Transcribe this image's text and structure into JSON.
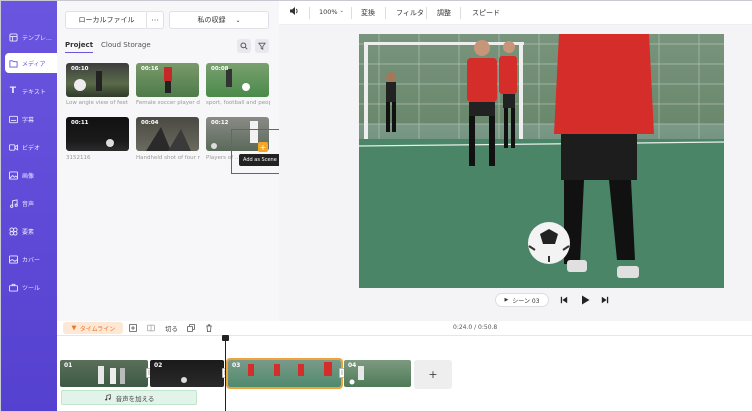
{
  "nav": {
    "items": [
      {
        "label": "テンプレ…",
        "icon": "template-icon"
      },
      {
        "label": "メディア",
        "icon": "media-icon"
      },
      {
        "label": "テキスト",
        "icon": "text-icon"
      },
      {
        "label": "字幕",
        "icon": "subtitle-icon"
      },
      {
        "label": "ビデオ",
        "icon": "video-icon"
      },
      {
        "label": "画像",
        "icon": "image-icon"
      },
      {
        "label": "音声",
        "icon": "music-icon"
      },
      {
        "label": "要素",
        "icon": "elements-icon"
      },
      {
        "label": "カバー",
        "icon": "cover-icon"
      },
      {
        "label": "ツール",
        "icon": "tools-icon"
      }
    ]
  },
  "panel": {
    "local_file_label": "ローカルファイル",
    "more_label": "···",
    "storage_dropdown": "私の収録",
    "tabs": [
      "Project",
      "Cloud Storage"
    ],
    "media": [
      {
        "duration": "00:10",
        "caption": "Low angle view of feet o…"
      },
      {
        "duration": "00:16",
        "caption": "Female soccer player dri…"
      },
      {
        "duration": "00:08",
        "caption": "sport, football and peopl…"
      },
      {
        "duration": "00:11",
        "caption": "3152116"
      },
      {
        "duration": "00:04",
        "caption": "Handheld shot of four n…"
      },
      {
        "duration": "00:12",
        "caption": "Players of …"
      }
    ],
    "tooltip": "Add as Scene",
    "add_symbol": "+"
  },
  "toolbar": {
    "zoom": "100%",
    "items": [
      "変換",
      "フィルタ",
      "調整",
      "スピード"
    ]
  },
  "player": {
    "scene_label": "シーン 03"
  },
  "timeline": {
    "label": "タイムライン",
    "cut_label": "切る",
    "time": "0:24.0 / 0:50.8",
    "clips": [
      "01",
      "02",
      "03",
      "04"
    ],
    "add_audio": "音声を加える",
    "add_clip_symbol": "+"
  },
  "colors": {
    "accent": "#6a55e0",
    "selection": "#f0a23c",
    "highlight": "#e53030"
  }
}
